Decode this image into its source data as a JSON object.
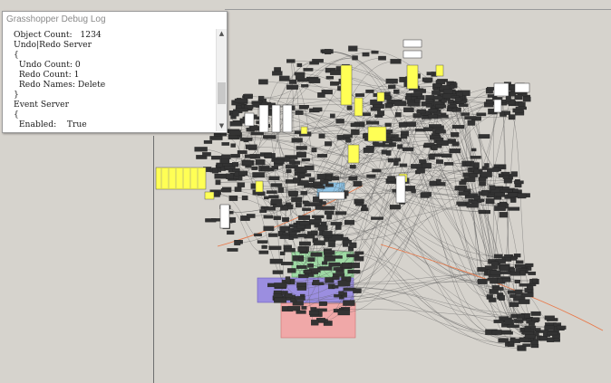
{
  "window": {
    "title": "Grasshopper Debug Log"
  },
  "log_lines": [
    "Object Count:   1234",
    "Undo|Redo Server",
    "{",
    "  Undo Count: 0",
    "  Redo Count: 1",
    "  Redo Names: Delete",
    "}",
    "Event Server",
    "{",
    "  Enabled:    True"
  ],
  "scrollbar": {
    "up_icon": "chevron-up-icon",
    "down_icon": "chevron-down-icon",
    "up_glyph": "▲",
    "down_glyph": "▼"
  },
  "canvas": {
    "background_color": "#d6d3cd",
    "wire_color": "#555555",
    "highlight_wire_color": "#e8794a",
    "group_colors": {
      "green": "#9ed9a4",
      "purple": "#9b8ee0",
      "red": "#f0a8a8",
      "blue": "#8fc5e8",
      "yellow": "#ffff55",
      "white": "#ffffff",
      "dark": "#333333"
    }
  }
}
